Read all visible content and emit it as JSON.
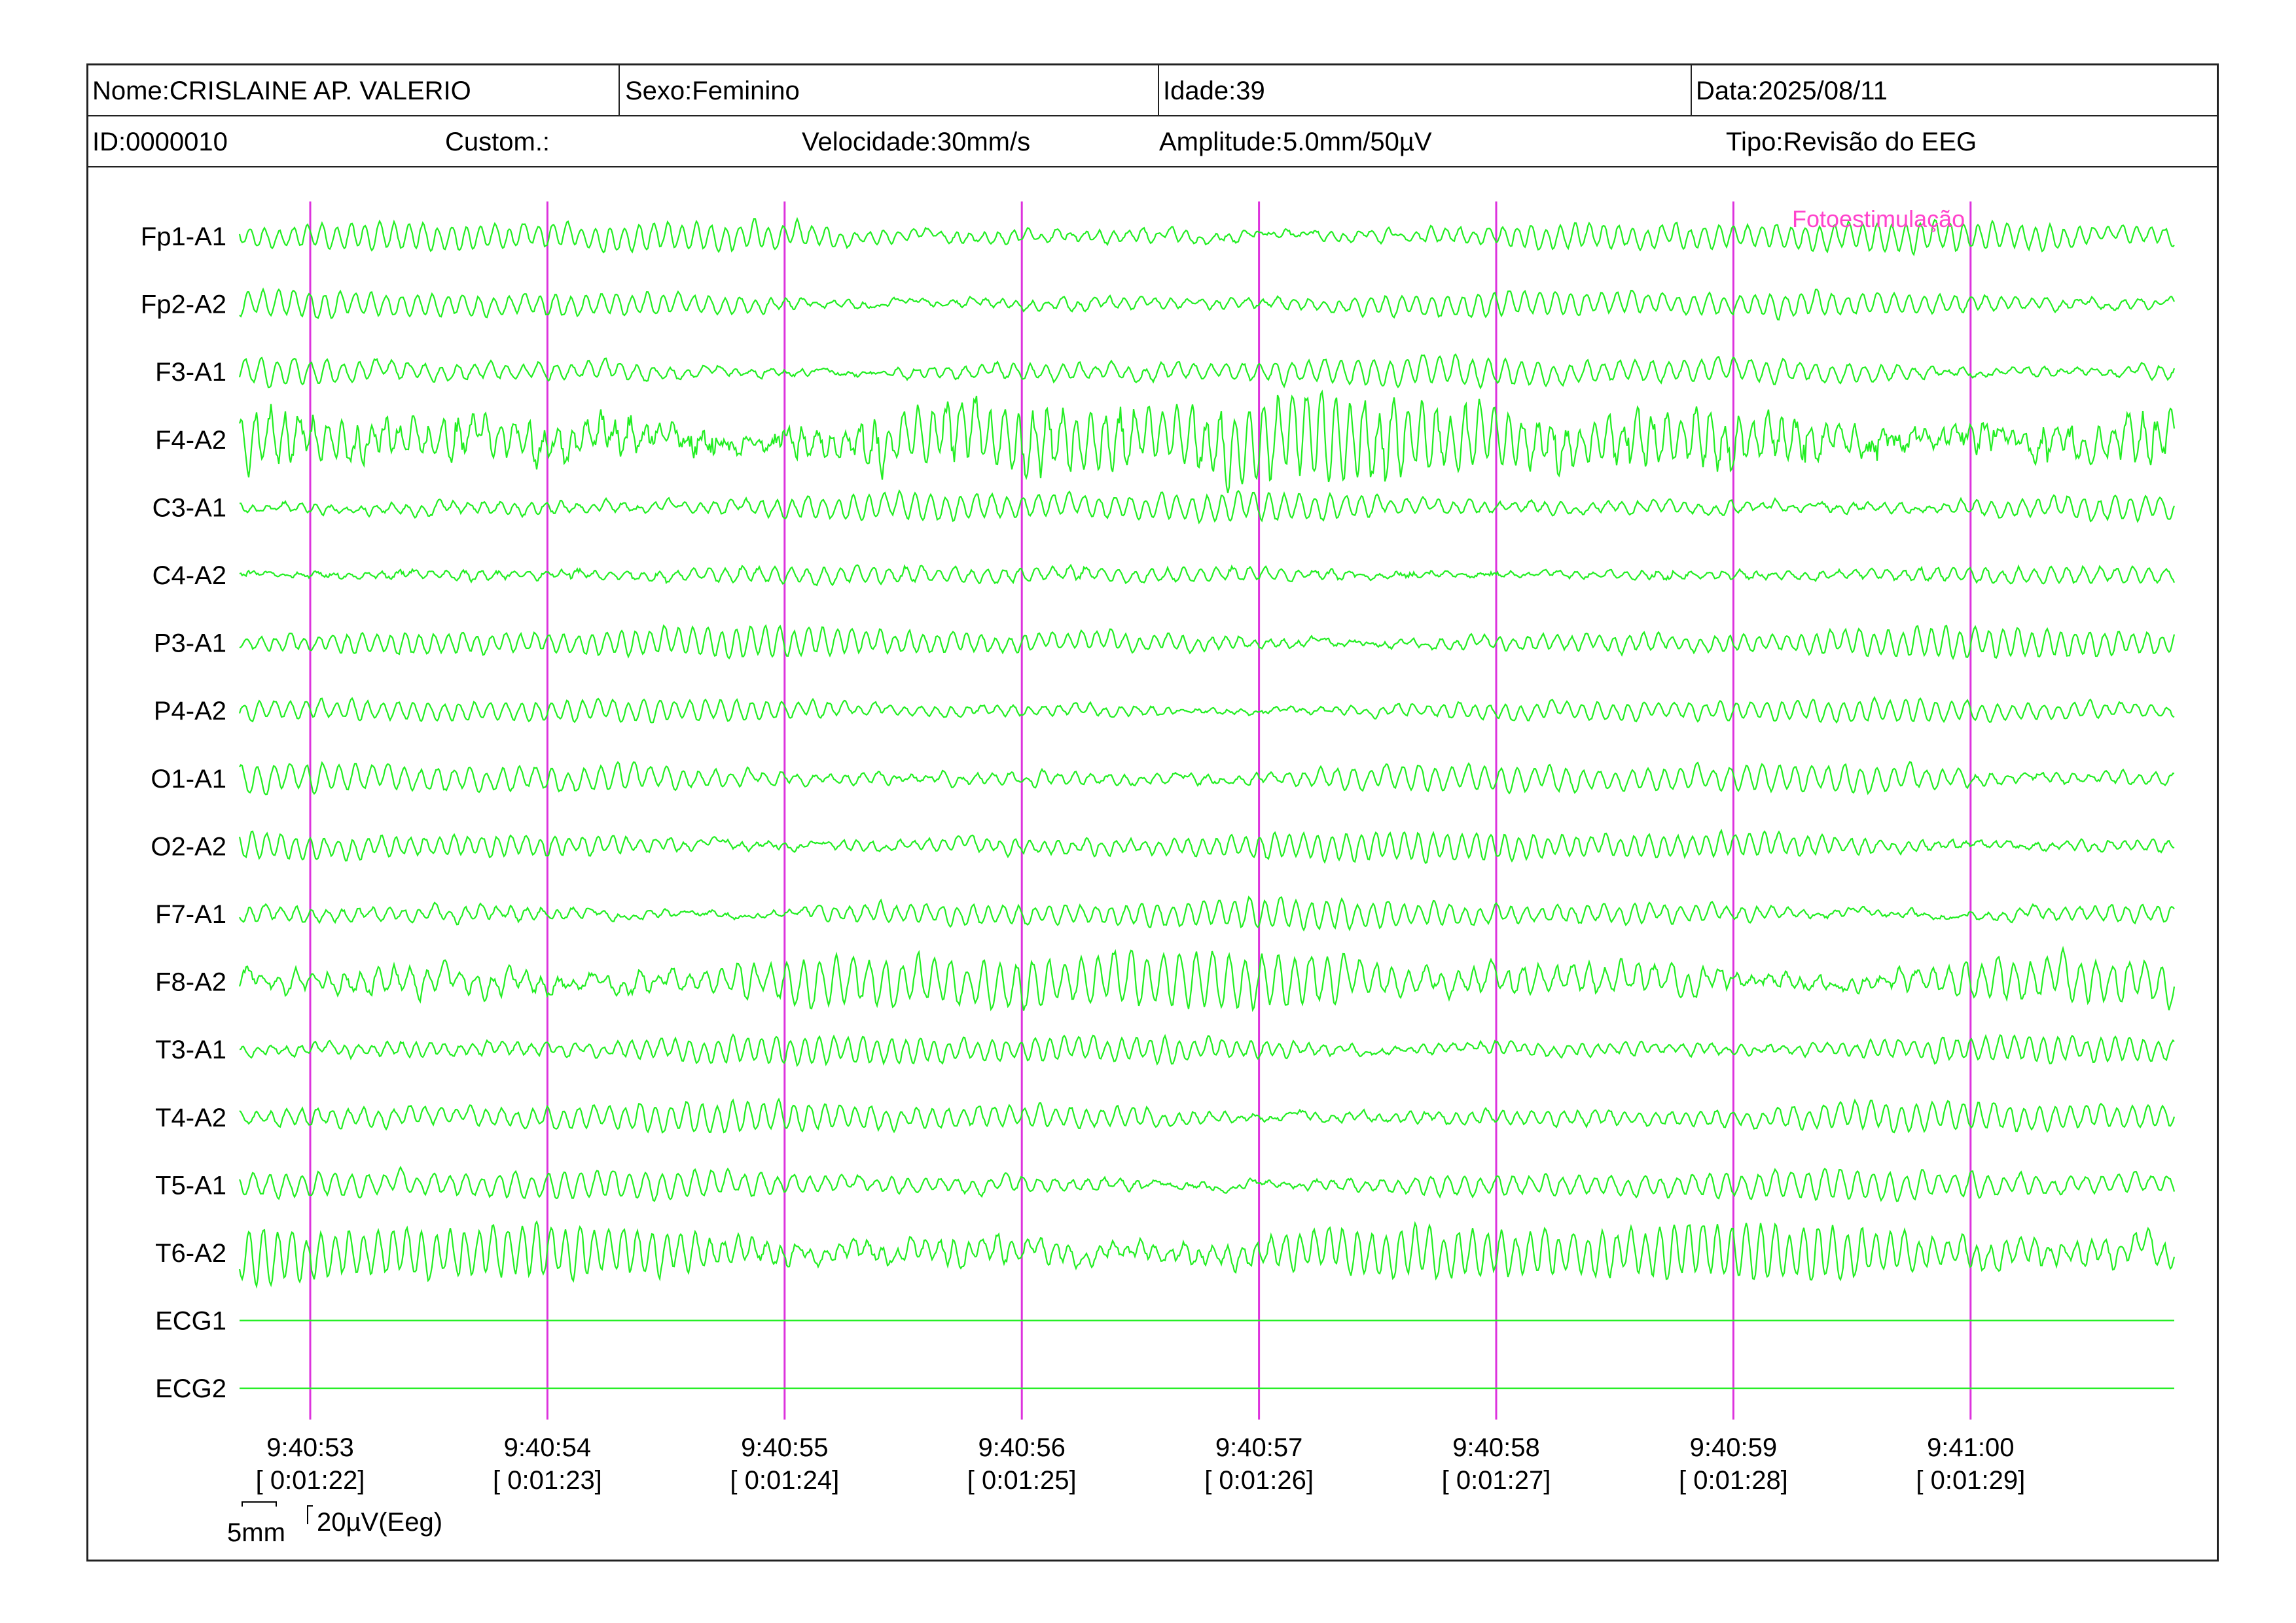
{
  "header": {
    "nome": "Nome:CRISLAINE AP. VALERIO",
    "sexo": "Sexo:Feminino",
    "idade": "Idade:39",
    "data": "Data:2025/08/11",
    "id": "ID:0000010",
    "custom": "Custom.:",
    "velocidade": "Velocidade:30mm/s",
    "amplitude": "Amplitude:5.0mm/50µV",
    "tipo": "Tipo:Revisão do EEG"
  },
  "colors": {
    "trace": "#22ee22",
    "marker": "#dd33dd",
    "annotation": "#ff44cc",
    "frame": "#222222"
  },
  "chart_data": {
    "type": "line",
    "channels": [
      {
        "name": "Fp1-A1",
        "amp": 0.5
      },
      {
        "name": "Fp2-A2",
        "amp": 0.45
      },
      {
        "name": "F3-A1",
        "amp": 0.5
      },
      {
        "name": "F4-A2",
        "amp": 1.4
      },
      {
        "name": "C3-A1",
        "amp": 0.5
      },
      {
        "name": "C4-A2",
        "amp": 0.3
      },
      {
        "name": "P3-A1",
        "amp": 0.5
      },
      {
        "name": "P4-A2",
        "amp": 0.4
      },
      {
        "name": "O1-A1",
        "amp": 0.5
      },
      {
        "name": "O2-A2",
        "amp": 0.5
      },
      {
        "name": "F7-A1",
        "amp": 0.5
      },
      {
        "name": "F8-A2",
        "amp": 1.0
      },
      {
        "name": "T3-A1",
        "amp": 0.5
      },
      {
        "name": "T4-A2",
        "amp": 0.5
      },
      {
        "name": "T5-A1",
        "amp": 0.5
      },
      {
        "name": "T6-A2",
        "amp": 1.0
      },
      {
        "name": "ECG1",
        "amp": 0
      },
      {
        "name": "ECG2",
        "amp": 0
      }
    ],
    "time_marks": [
      {
        "time": "9:40:53",
        "elapsed": "[ 0:01:22]"
      },
      {
        "time": "9:40:54",
        "elapsed": "[ 0:01:23]"
      },
      {
        "time": "9:40:55",
        "elapsed": "[ 0:01:24]"
      },
      {
        "time": "9:40:56",
        "elapsed": "[ 0:01:25]"
      },
      {
        "time": "9:40:57",
        "elapsed": "[ 0:01:26]"
      },
      {
        "time": "9:40:58",
        "elapsed": "[ 0:01:27]"
      },
      {
        "time": "9:40:59",
        "elapsed": "[ 0:01:28]"
      },
      {
        "time": "9:41:00",
        "elapsed": "[ 0:01:29]"
      }
    ],
    "annotation": "Fotoestimulação",
    "scale_time": "5mm",
    "scale_amp": "20µV(Eeg)"
  }
}
